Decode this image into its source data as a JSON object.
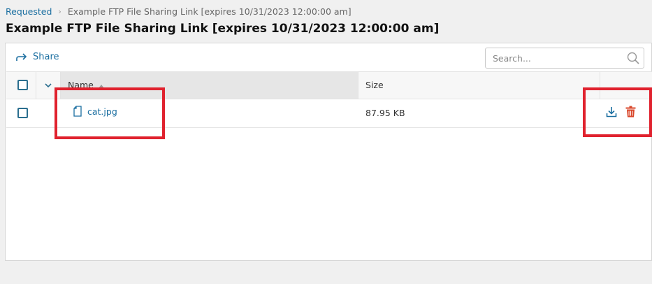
{
  "breadcrumb": {
    "parent": "Requested",
    "current": "Example FTP File Sharing Link [expires 10/31/2023 12:00:00 am]"
  },
  "page_title": "Example FTP File Sharing Link [expires 10/31/2023 12:00:00 am]",
  "toolbar": {
    "share_label": "Share",
    "search_placeholder": "Search...",
    "search_value": ""
  },
  "table": {
    "columns": [
      "Name",
      "Size"
    ],
    "sort": {
      "column": "Name",
      "direction": "ascending"
    },
    "rows": [
      {
        "name": "cat.jpg",
        "size": "87.95 KB",
        "selected": false
      }
    ]
  },
  "icons": {
    "share": "share-arrow-icon",
    "search": "search-icon",
    "file": "file-icon",
    "download": "download-icon",
    "delete": "trash-icon",
    "dropdown": "chevron-down-icon",
    "sort": "sort-ascending-icon"
  },
  "colors": {
    "link": "#1a6ea0",
    "checkbox": "#2a6e8e",
    "delete": "#d9472b",
    "highlight": "#e0222e",
    "sorted_header_bg": "#e6e6e6"
  }
}
